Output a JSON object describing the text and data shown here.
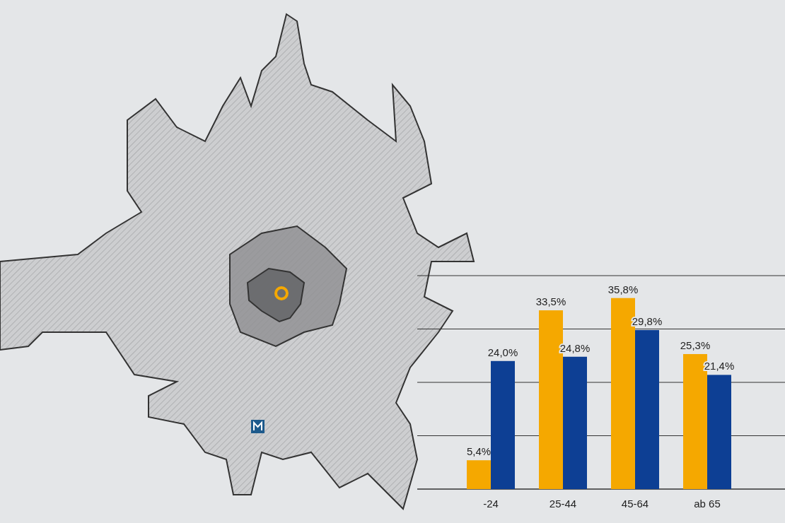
{
  "map": {
    "chart_data": {
      "type": "bar",
      "categories": [
        "-24",
        "25-44",
        "45-64",
        "ab 65"
      ],
      "series": [
        {
          "color": "#f5a800",
          "values": [
            5.4,
            33.5,
            35.8,
            25.3
          ],
          "value_labels": [
            "5,4%",
            "33,5%",
            "35,8%",
            "25,3%"
          ]
        },
        {
          "color": "#0d3f94",
          "values": [
            24.0,
            24.8,
            29.8,
            21.4
          ],
          "value_labels": [
            "24,0%",
            "24,8%",
            "29,8%",
            "21,4%"
          ]
        }
      ]
    }
  }
}
